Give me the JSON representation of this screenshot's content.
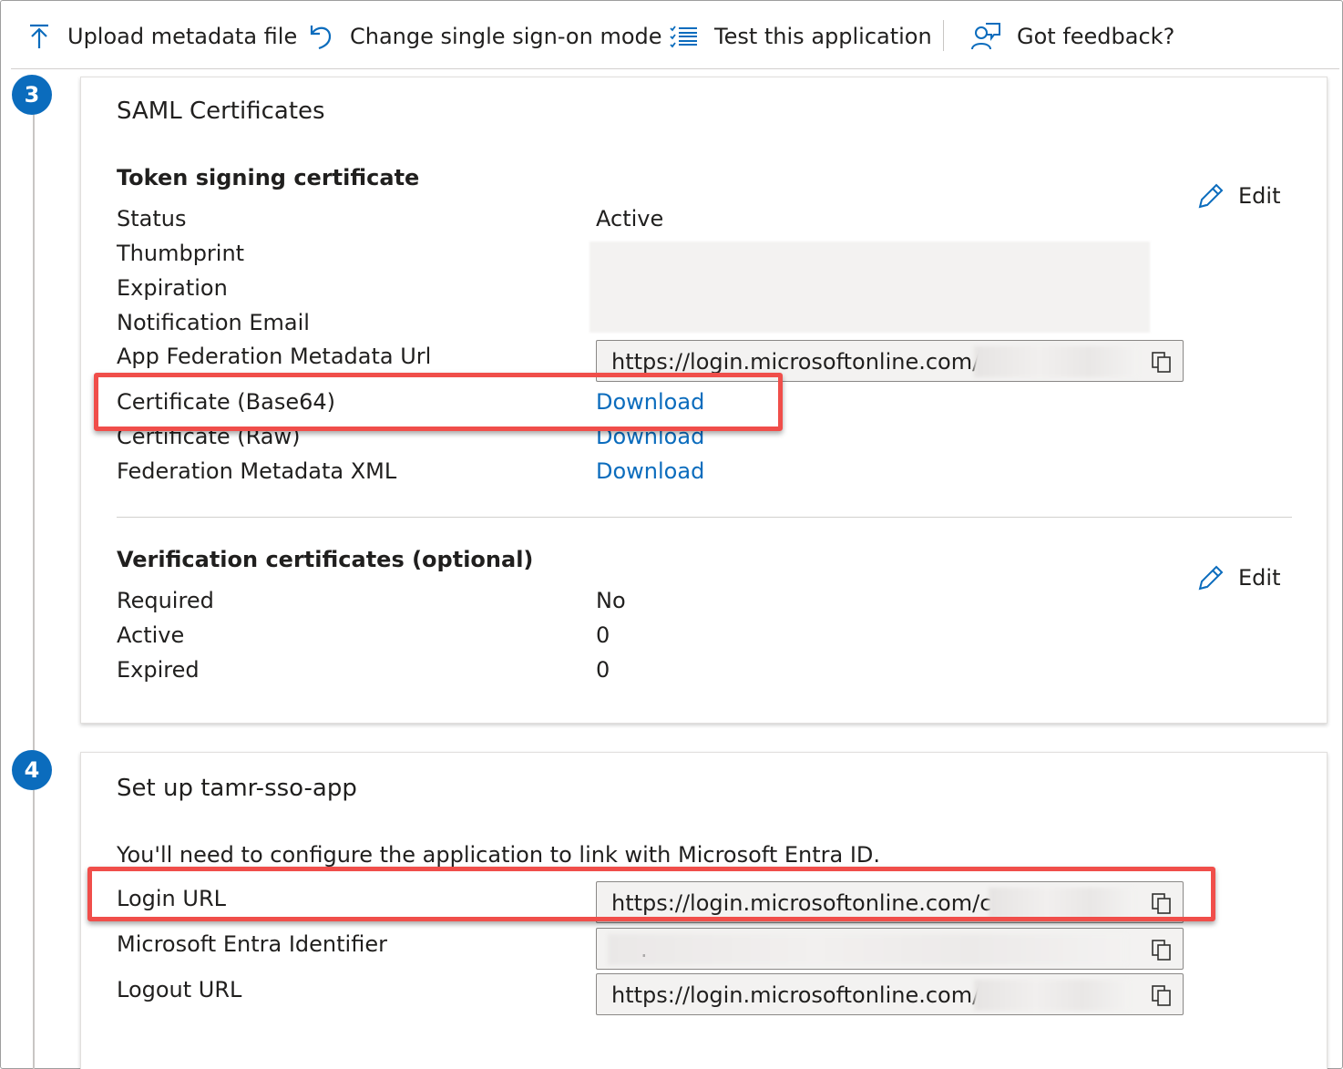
{
  "toolbar": {
    "upload_label": "Upload metadata file",
    "change_mode_label": "Change single sign-on mode",
    "test_label": "Test this application",
    "feedback_label": "Got feedback?"
  },
  "steps": {
    "step3": "3",
    "step4": "4"
  },
  "saml": {
    "title": "SAML Certificates",
    "token_title": "Token signing certificate",
    "edit_label": "Edit",
    "status_label": "Status",
    "status_value": "Active",
    "thumbprint_label": "Thumbprint",
    "expiration_label": "Expiration",
    "notification_label": "Notification Email",
    "metadata_url_label": "App Federation Metadata Url",
    "metadata_url_value": "https://login.microsoftonline.com/cd",
    "cert_base64_label": "Certificate (Base64)",
    "cert_raw_label": "Certificate (Raw)",
    "fed_xml_label": "Federation Metadata XML",
    "download_label": "Download",
    "verification_title": "Verification certificates (optional)",
    "verification_edit_label": "Edit",
    "required_label": "Required",
    "required_value": "No",
    "active_label": "Active",
    "active_value": "0",
    "expired_label": "Expired",
    "expired_value": "0"
  },
  "setup": {
    "title": "Set up tamr-sso-app",
    "description": "You'll need to configure the application to link with Microsoft Entra ID.",
    "login_url_label": "Login URL",
    "login_url_value": "https://login.microsoftonline.com/cd1",
    "entra_id_label": "Microsoft Entra Identifier",
    "entra_id_value": ".",
    "logout_url_label": "Logout URL",
    "logout_url_value": "https://login.microsoftonline.com/cd"
  },
  "colors": {
    "accent": "#0b6cbd",
    "highlight": "#f04e4a"
  },
  "icons": [
    "upload-icon",
    "undo-icon",
    "list-icon",
    "feedback-icon",
    "pencil-icon",
    "copy-icon"
  ]
}
